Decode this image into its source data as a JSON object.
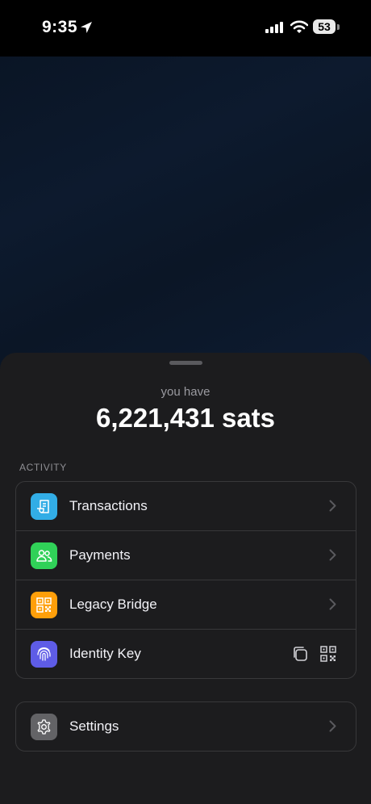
{
  "status_bar": {
    "time": "9:35",
    "battery_level": "53",
    "icons": [
      "location-arrow-icon",
      "cellular-signal-icon",
      "wifi-icon",
      "battery-icon"
    ]
  },
  "balance": {
    "label": "you have",
    "value": "6,221,431 sats"
  },
  "activity": {
    "header": "ACTIVITY",
    "items": [
      {
        "label": "Transactions",
        "icon": "receipt-icon",
        "color": "#32ade6"
      },
      {
        "label": "Payments",
        "icon": "people-icon",
        "color": "#30d158"
      },
      {
        "label": "Legacy Bridge",
        "icon": "qr-code-icon",
        "color": "#ff9f0a"
      },
      {
        "label": "Identity Key",
        "icon": "fingerprint-icon",
        "color": "#5e5ce6"
      }
    ]
  },
  "settings": {
    "label": "Settings",
    "icon": "gear-icon",
    "color": "#636366"
  }
}
